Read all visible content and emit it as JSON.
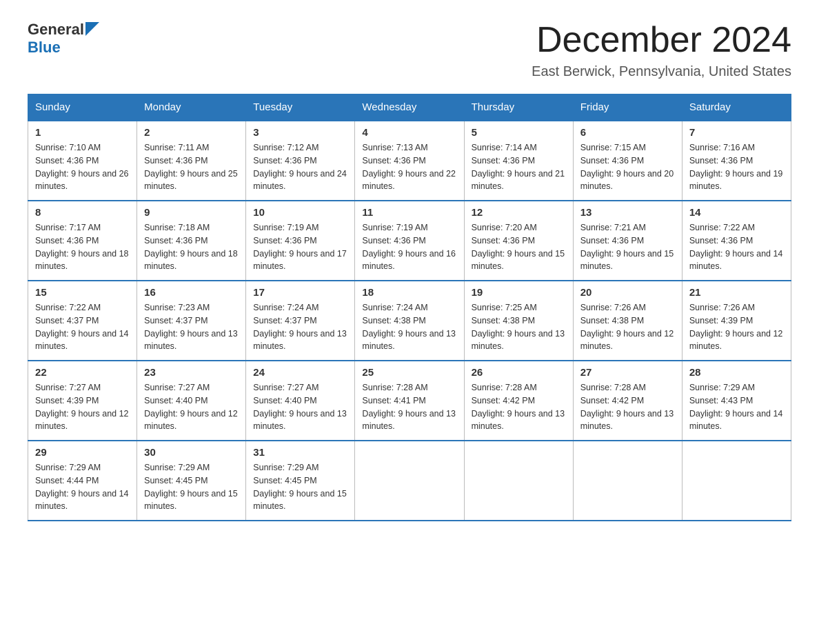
{
  "header": {
    "logo_general": "General",
    "logo_blue": "Blue",
    "title": "December 2024",
    "location": "East Berwick, Pennsylvania, United States"
  },
  "weekdays": [
    "Sunday",
    "Monday",
    "Tuesday",
    "Wednesday",
    "Thursday",
    "Friday",
    "Saturday"
  ],
  "weeks": [
    [
      {
        "day": "1",
        "sunrise": "7:10 AM",
        "sunset": "4:36 PM",
        "daylight": "9 hours and 26 minutes."
      },
      {
        "day": "2",
        "sunrise": "7:11 AM",
        "sunset": "4:36 PM",
        "daylight": "9 hours and 25 minutes."
      },
      {
        "day": "3",
        "sunrise": "7:12 AM",
        "sunset": "4:36 PM",
        "daylight": "9 hours and 24 minutes."
      },
      {
        "day": "4",
        "sunrise": "7:13 AM",
        "sunset": "4:36 PM",
        "daylight": "9 hours and 22 minutes."
      },
      {
        "day": "5",
        "sunrise": "7:14 AM",
        "sunset": "4:36 PM",
        "daylight": "9 hours and 21 minutes."
      },
      {
        "day": "6",
        "sunrise": "7:15 AM",
        "sunset": "4:36 PM",
        "daylight": "9 hours and 20 minutes."
      },
      {
        "day": "7",
        "sunrise": "7:16 AM",
        "sunset": "4:36 PM",
        "daylight": "9 hours and 19 minutes."
      }
    ],
    [
      {
        "day": "8",
        "sunrise": "7:17 AM",
        "sunset": "4:36 PM",
        "daylight": "9 hours and 18 minutes."
      },
      {
        "day": "9",
        "sunrise": "7:18 AM",
        "sunset": "4:36 PM",
        "daylight": "9 hours and 18 minutes."
      },
      {
        "day": "10",
        "sunrise": "7:19 AM",
        "sunset": "4:36 PM",
        "daylight": "9 hours and 17 minutes."
      },
      {
        "day": "11",
        "sunrise": "7:19 AM",
        "sunset": "4:36 PM",
        "daylight": "9 hours and 16 minutes."
      },
      {
        "day": "12",
        "sunrise": "7:20 AM",
        "sunset": "4:36 PM",
        "daylight": "9 hours and 15 minutes."
      },
      {
        "day": "13",
        "sunrise": "7:21 AM",
        "sunset": "4:36 PM",
        "daylight": "9 hours and 15 minutes."
      },
      {
        "day": "14",
        "sunrise": "7:22 AM",
        "sunset": "4:36 PM",
        "daylight": "9 hours and 14 minutes."
      }
    ],
    [
      {
        "day": "15",
        "sunrise": "7:22 AM",
        "sunset": "4:37 PM",
        "daylight": "9 hours and 14 minutes."
      },
      {
        "day": "16",
        "sunrise": "7:23 AM",
        "sunset": "4:37 PM",
        "daylight": "9 hours and 13 minutes."
      },
      {
        "day": "17",
        "sunrise": "7:24 AM",
        "sunset": "4:37 PM",
        "daylight": "9 hours and 13 minutes."
      },
      {
        "day": "18",
        "sunrise": "7:24 AM",
        "sunset": "4:38 PM",
        "daylight": "9 hours and 13 minutes."
      },
      {
        "day": "19",
        "sunrise": "7:25 AM",
        "sunset": "4:38 PM",
        "daylight": "9 hours and 13 minutes."
      },
      {
        "day": "20",
        "sunrise": "7:26 AM",
        "sunset": "4:38 PM",
        "daylight": "9 hours and 12 minutes."
      },
      {
        "day": "21",
        "sunrise": "7:26 AM",
        "sunset": "4:39 PM",
        "daylight": "9 hours and 12 minutes."
      }
    ],
    [
      {
        "day": "22",
        "sunrise": "7:27 AM",
        "sunset": "4:39 PM",
        "daylight": "9 hours and 12 minutes."
      },
      {
        "day": "23",
        "sunrise": "7:27 AM",
        "sunset": "4:40 PM",
        "daylight": "9 hours and 12 minutes."
      },
      {
        "day": "24",
        "sunrise": "7:27 AM",
        "sunset": "4:40 PM",
        "daylight": "9 hours and 13 minutes."
      },
      {
        "day": "25",
        "sunrise": "7:28 AM",
        "sunset": "4:41 PM",
        "daylight": "9 hours and 13 minutes."
      },
      {
        "day": "26",
        "sunrise": "7:28 AM",
        "sunset": "4:42 PM",
        "daylight": "9 hours and 13 minutes."
      },
      {
        "day": "27",
        "sunrise": "7:28 AM",
        "sunset": "4:42 PM",
        "daylight": "9 hours and 13 minutes."
      },
      {
        "day": "28",
        "sunrise": "7:29 AM",
        "sunset": "4:43 PM",
        "daylight": "9 hours and 14 minutes."
      }
    ],
    [
      {
        "day": "29",
        "sunrise": "7:29 AM",
        "sunset": "4:44 PM",
        "daylight": "9 hours and 14 minutes."
      },
      {
        "day": "30",
        "sunrise": "7:29 AM",
        "sunset": "4:45 PM",
        "daylight": "9 hours and 15 minutes."
      },
      {
        "day": "31",
        "sunrise": "7:29 AM",
        "sunset": "4:45 PM",
        "daylight": "9 hours and 15 minutes."
      },
      null,
      null,
      null,
      null
    ]
  ],
  "labels": {
    "sunrise": "Sunrise:",
    "sunset": "Sunset:",
    "daylight": "Daylight:"
  }
}
